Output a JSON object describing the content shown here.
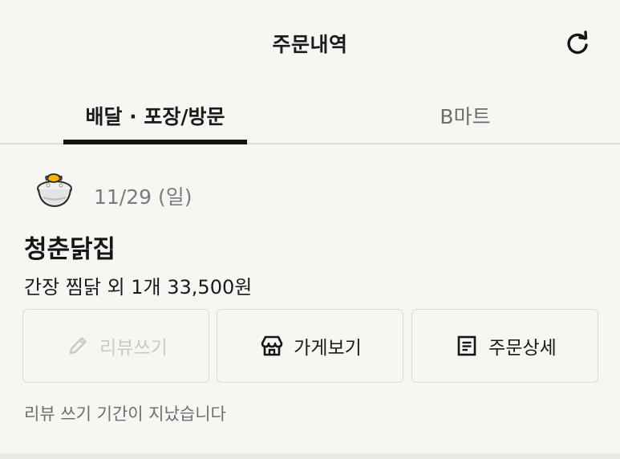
{
  "header": {
    "title": "주문내역",
    "refresh_icon": "refresh-icon"
  },
  "tabs": [
    {
      "label": "배달 · 포장/방문",
      "active": true
    },
    {
      "label": "B마트",
      "active": false
    }
  ],
  "order": {
    "date": "11/29 (일)",
    "store_logo_icon": "rice-bowl-icon",
    "store_name": "청춘닭집",
    "summary": "간장 찜닭 외 1개 33,500원",
    "buttons": {
      "review": {
        "label": "리뷰쓰기",
        "icon": "pencil-icon",
        "enabled": false
      },
      "store": {
        "label": "가게보기",
        "icon": "store-icon"
      },
      "detail": {
        "label": "주문상세",
        "icon": "receipt-icon"
      }
    },
    "review_notice": "리뷰 쓰기 기간이 지났습니다"
  },
  "colors": {
    "background": "#f7f6f2",
    "text": "#1b1b1b",
    "muted": "#7b7b7b",
    "disabled": "#c9c9c6",
    "border": "#d8d8d4"
  }
}
